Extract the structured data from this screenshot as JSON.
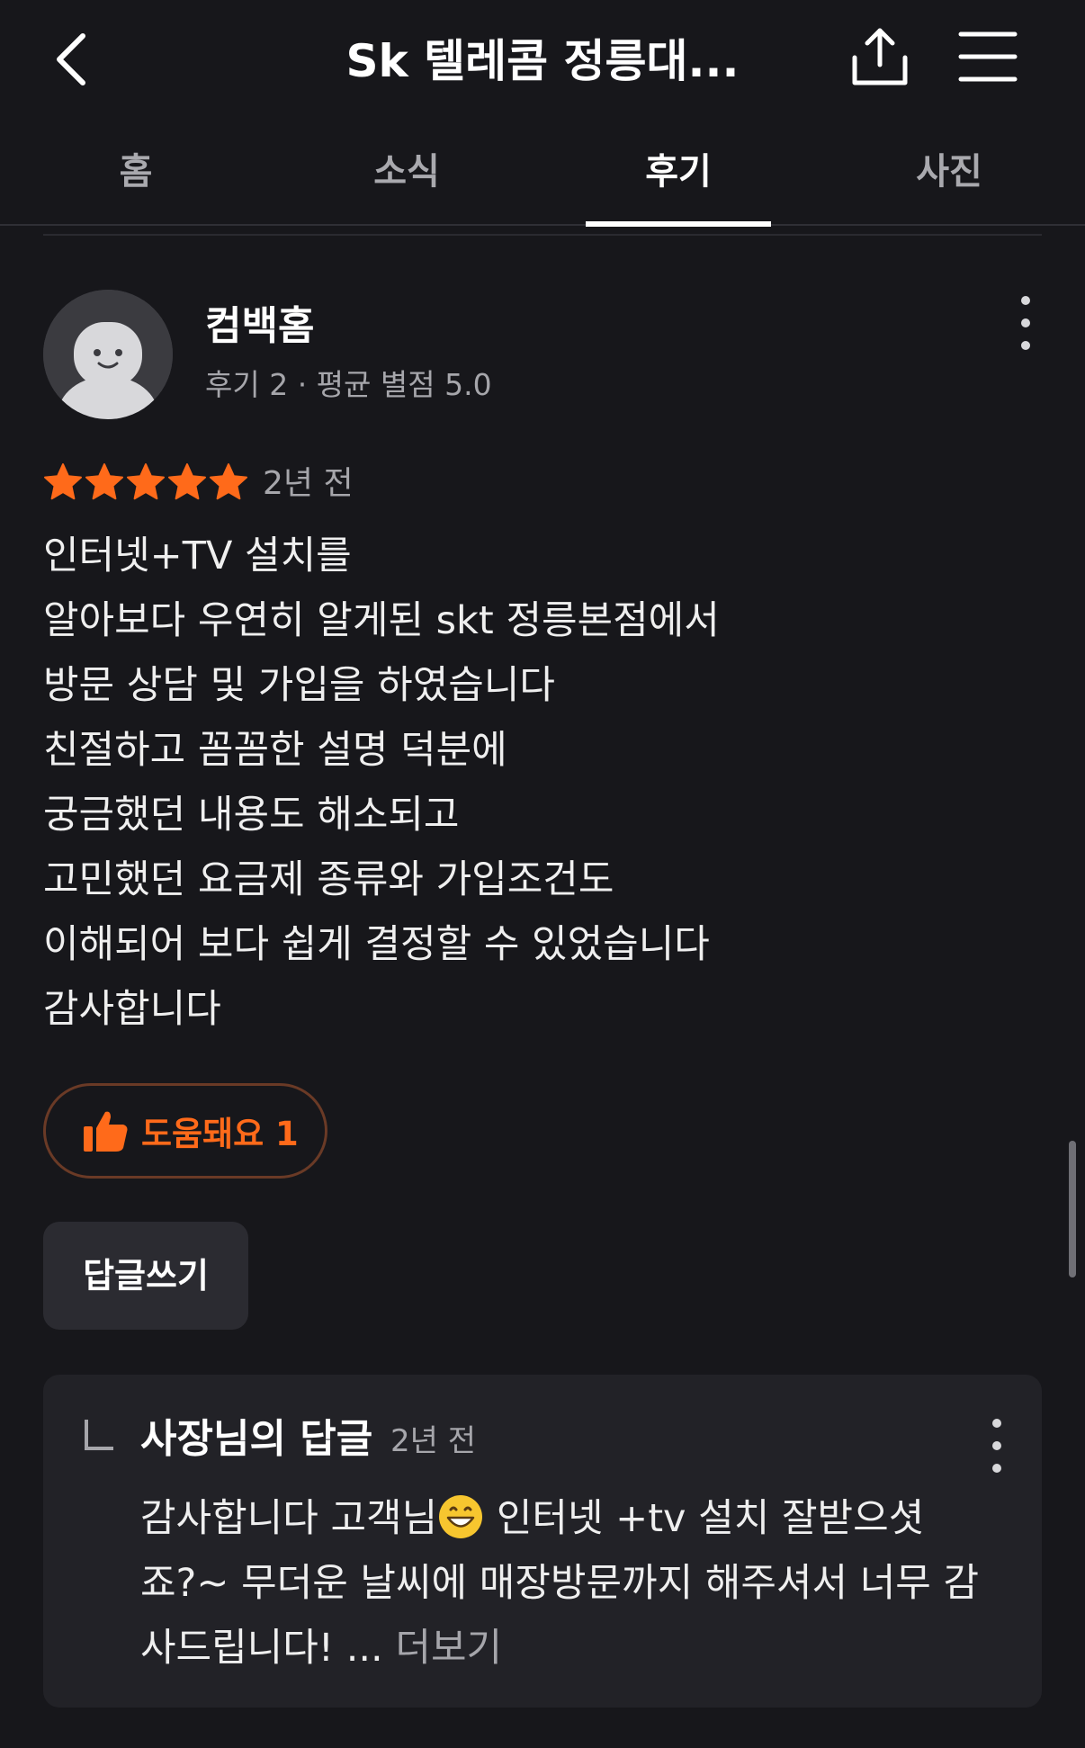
{
  "header": {
    "title": "Sk 텔레콤 정릉대...",
    "back_icon": "chevron-left-icon",
    "share_icon": "share-icon",
    "menu_icon": "hamburger-menu-icon"
  },
  "tabs": [
    {
      "label": "홈",
      "active": false
    },
    {
      "label": "소식",
      "active": false
    },
    {
      "label": "후기",
      "active": true
    },
    {
      "label": "사진",
      "active": false
    }
  ],
  "review": {
    "author": "컴백홈",
    "stats": "후기 2 · 평균 별점 5.0",
    "rating": 5,
    "date": "2년 전",
    "lines": [
      "인터넷+TV 설치를",
      "알아보다 우연히 알게된 skt 정릉본점에서",
      "방문 상담 및 가입을 하였습니다",
      "친절하고 꼼꼼한 설명 덕분에",
      "궁금했던 내용도 해소되고",
      "고민했던 요금제 종류와 가입조건도",
      "이해되어 보다 쉽게 결정할 수 있었습니다",
      "감사합니다"
    ],
    "helpful_label": "도움돼요 1",
    "reply_button": "답글쓰기"
  },
  "owner_reply": {
    "title": "사장님의 답글",
    "date": "2년 전",
    "line1_a": "감사합니다 고객님",
    "line1_b": " 인터넷 +tv 설치 잘받으셧",
    "line2": "죠?~ 무더운 날씨에 매장방문까지 해주셔서 너무 감",
    "line3": "사드립니다! ... ",
    "more": "더보기"
  },
  "colors": {
    "background": "#17171b",
    "accent": "#ff6a1a",
    "star": "#ff6a1a",
    "card": "#222227"
  }
}
